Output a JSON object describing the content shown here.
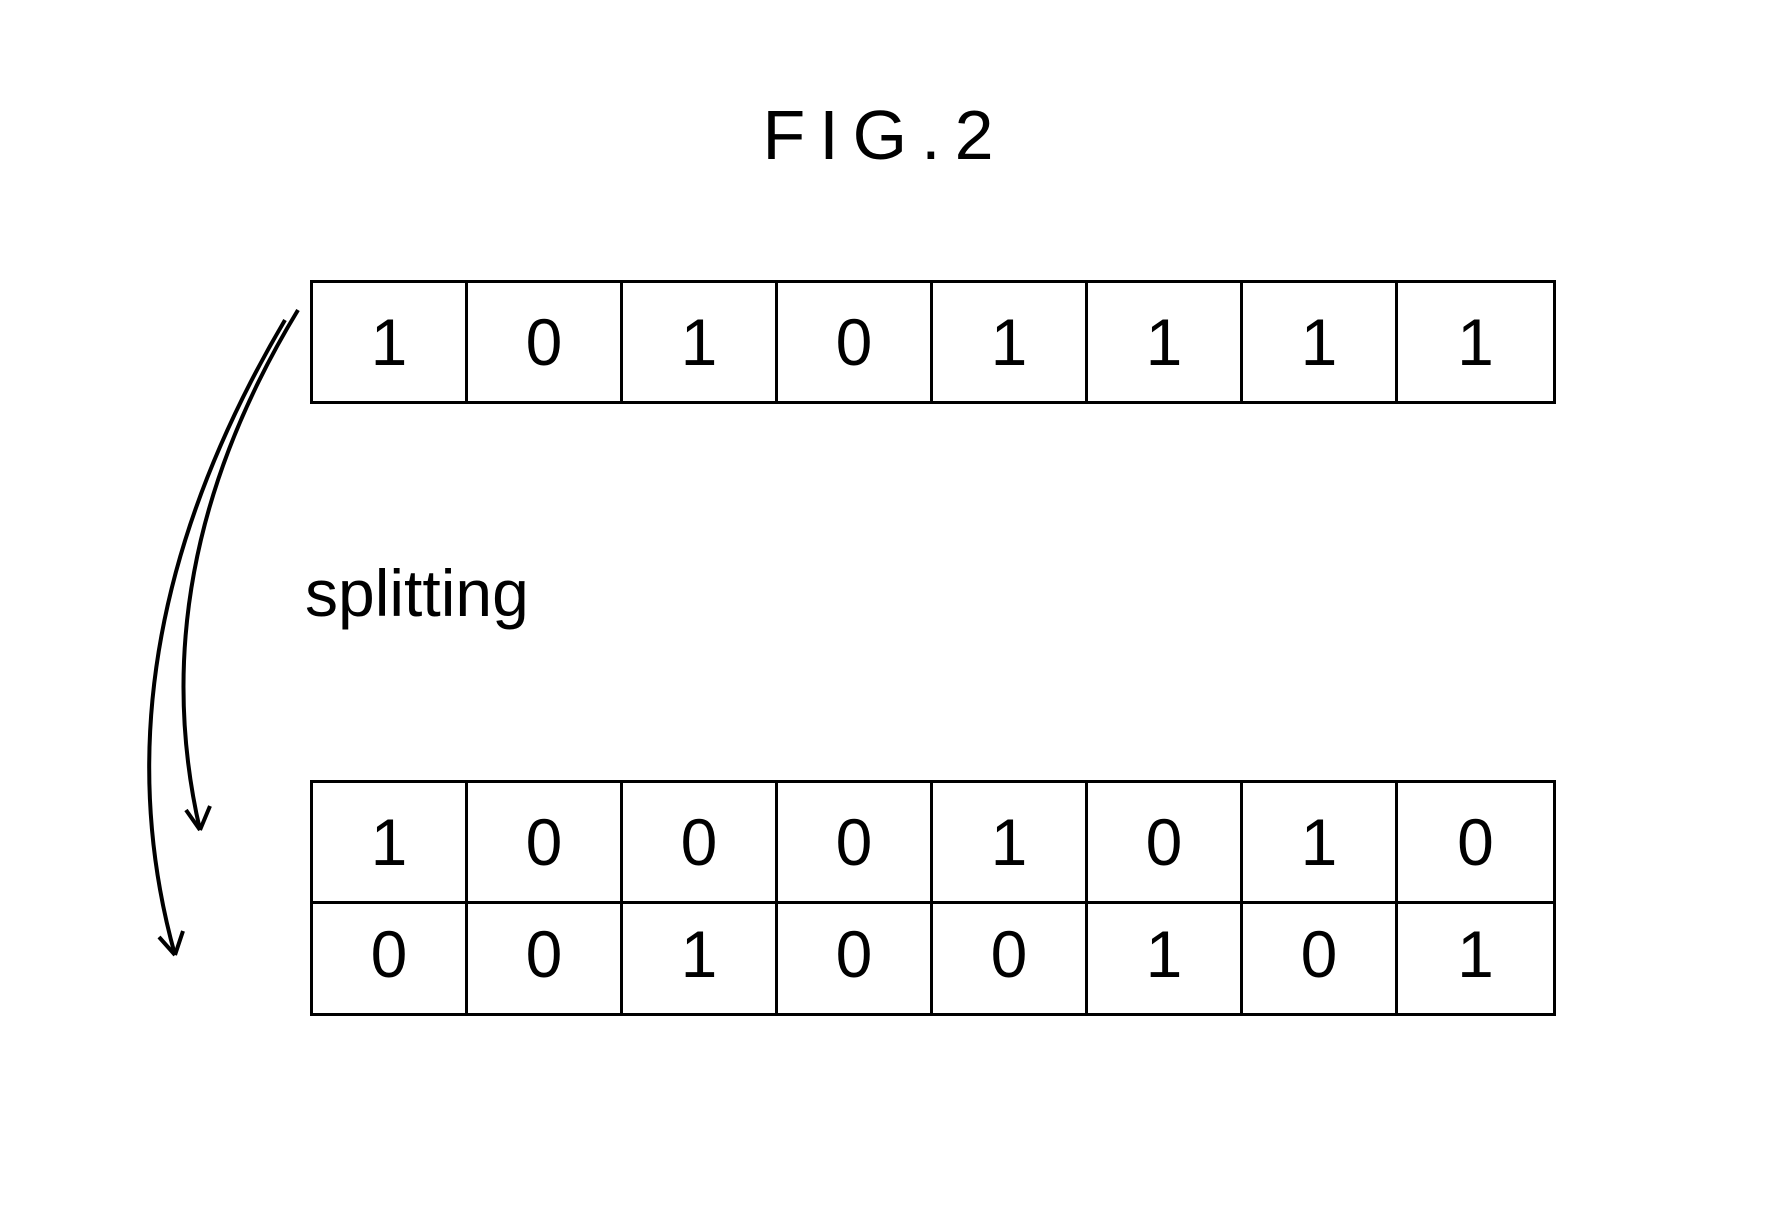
{
  "title": "FIG.2",
  "splitting_label": "splitting",
  "top_row": {
    "bits": [
      "1",
      "0",
      "1",
      "0",
      "1",
      "1",
      "1",
      "1"
    ]
  },
  "middle_row": {
    "bits": [
      "1",
      "0",
      "0",
      "0",
      "1",
      "0",
      "1",
      "0"
    ]
  },
  "bottom_row": {
    "bits": [
      "0",
      "0",
      "1",
      "0",
      "0",
      "1",
      "0",
      "1"
    ]
  }
}
